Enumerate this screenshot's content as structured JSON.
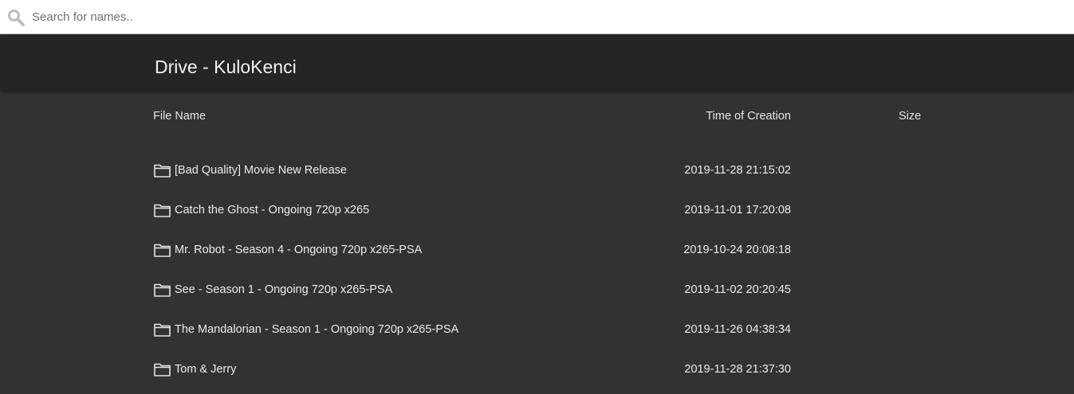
{
  "search": {
    "placeholder": "Search for names..",
    "value": "",
    "icon": "search-icon"
  },
  "header": {
    "title": "Drive - KuloKenci"
  },
  "table": {
    "columns": {
      "name": "File Name",
      "time": "Time of Creation",
      "size": "Size"
    },
    "rows": [
      {
        "icon": "folder-icon",
        "name": "[Bad Quality] Movie New Release",
        "time": "2019-11-28 21:15:02",
        "size": ""
      },
      {
        "icon": "folder-icon",
        "name": "Catch the Ghost - Ongoing 720p x265",
        "time": "2019-11-01 17:20:08",
        "size": ""
      },
      {
        "icon": "folder-icon",
        "name": "Mr. Robot - Season 4 - Ongoing 720p x265-PSA",
        "time": "2019-10-24 20:08:18",
        "size": ""
      },
      {
        "icon": "folder-icon",
        "name": "See - Season 1 - Ongoing 720p x265-PSA",
        "time": "2019-11-02 20:20:45",
        "size": ""
      },
      {
        "icon": "folder-icon",
        "name": "The Mandalorian - Season 1 - Ongoing 720p x265-PSA",
        "time": "2019-11-26 04:38:34",
        "size": ""
      },
      {
        "icon": "folder-icon",
        "name": "Tom & Jerry",
        "time": "2019-11-28 21:37:30",
        "size": ""
      }
    ]
  },
  "colors": {
    "background": "#333131",
    "header": "#252527",
    "text": "#ececec",
    "search_bg": "#ffffff",
    "icon_gray": "#bdbdbd"
  }
}
